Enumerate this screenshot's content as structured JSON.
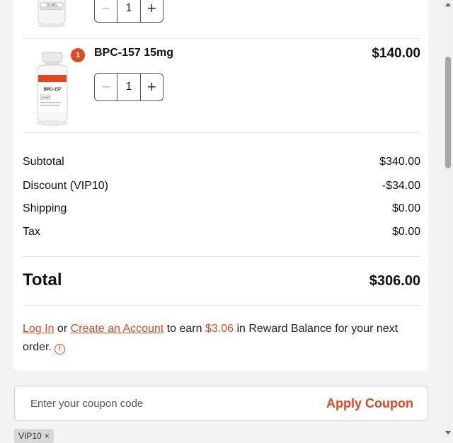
{
  "items": [
    {
      "name": "",
      "price": "",
      "quantity": "1",
      "badge": "",
      "vial_label_lines": [
        "10 MG"
      ]
    },
    {
      "name": "BPC-157 15mg",
      "price": "$140.00",
      "quantity": "1",
      "badge": "1",
      "vial_label_lines": [
        "BPC-157",
        "15 MG"
      ]
    }
  ],
  "stepper": {
    "minus": "−",
    "plus": "+"
  },
  "summary": {
    "subtotal_label": "Subtotal",
    "subtotal_value": "$340.00",
    "discount_label": "Discount (VIP10)",
    "discount_value": "-$34.00",
    "shipping_label": "Shipping",
    "shipping_value": "$0.00",
    "tax_label": "Tax",
    "tax_value": "$0.00",
    "total_label": "Total",
    "total_value": "$306.00"
  },
  "reward": {
    "login_link": "Log In",
    "or_text": " or ",
    "create_link": "Create an Account",
    "earn_text": " to earn ",
    "amount": "$3.06",
    "rest_text": " in Reward Balance for your next order.",
    "info_icon": "!"
  },
  "coupon": {
    "placeholder": "Enter your coupon code",
    "apply_label": "Apply Coupon",
    "applied_code": "VIP10",
    "remove_icon": "×"
  },
  "colors": {
    "accent": "#e0491f",
    "background": "#f3f3f3",
    "card": "#ffffff"
  }
}
